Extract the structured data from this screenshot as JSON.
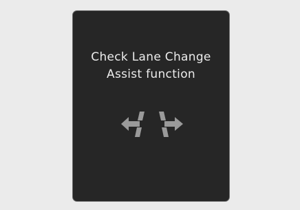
{
  "warning_popup": {
    "message_line1": "Check Lane Change",
    "message_line2": "Assist function",
    "icon": "lane-change-assist-icon",
    "colors": {
      "background": "#262626",
      "border": "#707070",
      "text": "#ececec",
      "icon": "#9a9a9a",
      "page": "#ebebeb"
    }
  }
}
